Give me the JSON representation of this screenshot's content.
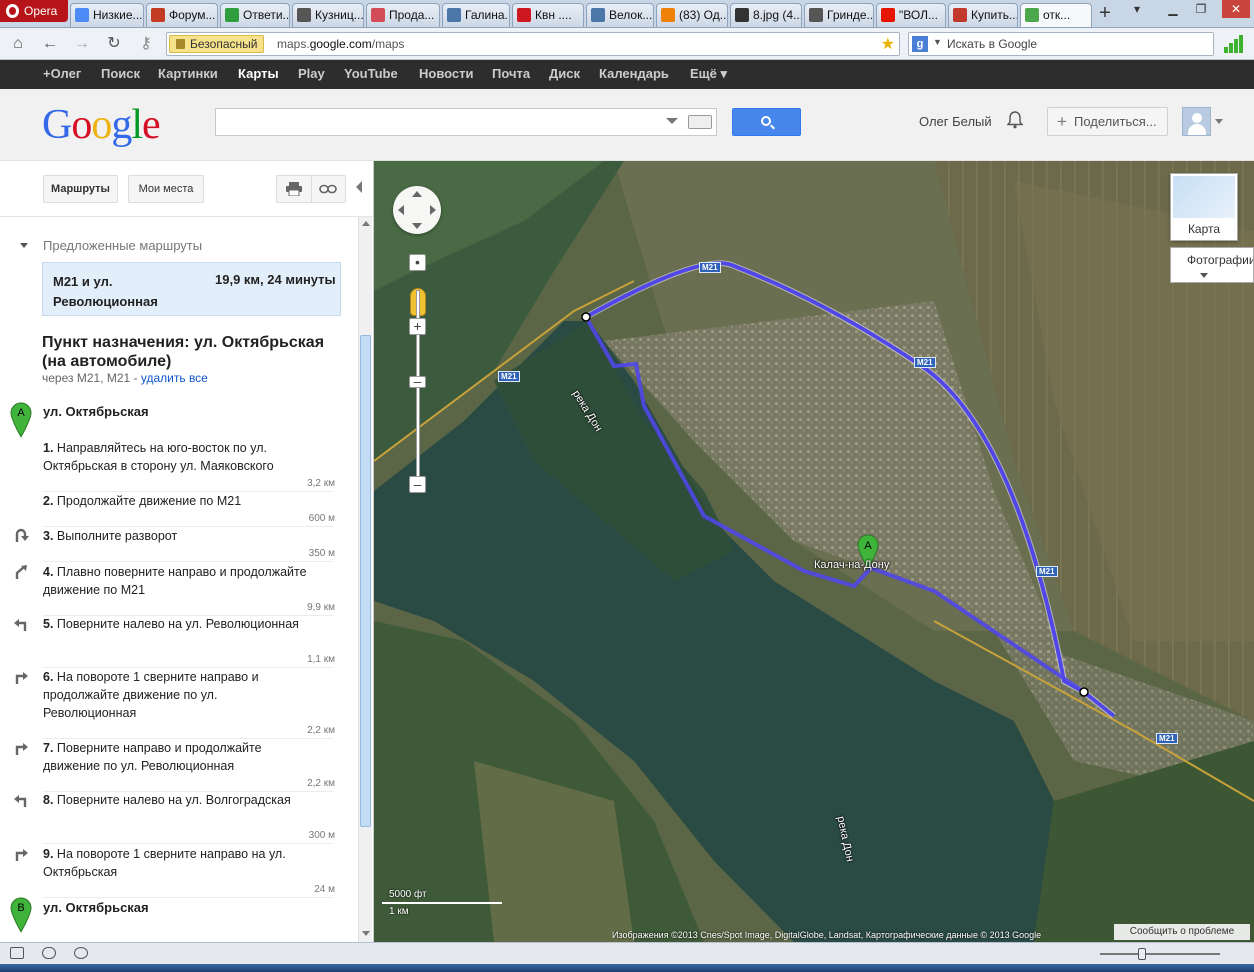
{
  "browser": {
    "menu_label": "Opera",
    "tabs": [
      {
        "label": "Низкие...",
        "icon": "chrome-icon",
        "color": "#4c8bf5"
      },
      {
        "label": "Форум...",
        "icon": "bike-icon",
        "color": "#c23b22"
      },
      {
        "label": "Ответи...",
        "icon": "leaf-icon",
        "color": "#2e9e3e"
      },
      {
        "label": "Кузниц...",
        "icon": "gear-icon",
        "color": "#555555"
      },
      {
        "label": "Прода...",
        "icon": "dots-icon",
        "color": "#d24d57"
      },
      {
        "label": "Галина...",
        "icon": "vk-icon",
        "color": "#4a76a8"
      },
      {
        "label": "Квн ....",
        "icon": "youtube-icon",
        "color": "#cc181e"
      },
      {
        "label": "Велок...",
        "icon": "vk-icon",
        "color": "#4a76a8"
      },
      {
        "label": "(83) Од...",
        "icon": "ok-icon",
        "color": "#ee8208"
      },
      {
        "label": "8.jpg (4...",
        "icon": "image-icon",
        "color": "#333333"
      },
      {
        "label": "Гринде...",
        "icon": "gear-icon",
        "color": "#555555"
      },
      {
        "label": "\"ВОЛ...",
        "icon": "yandex-icon",
        "color": "#e61400"
      },
      {
        "label": "Купить...",
        "icon": "vt-icon",
        "color": "#c0392b"
      },
      {
        "label": "отк...",
        "icon": "maps-icon",
        "color": "#4ca64c"
      }
    ],
    "security_label": "Безопасный",
    "url_prefix": "maps.",
    "url_domain": "google.com",
    "url_suffix": "/maps",
    "search_placeholder": "Искать в Google"
  },
  "gbar": {
    "items": [
      "+Олег",
      "Поиск",
      "Картинки",
      "Карты",
      "Play",
      "YouTube",
      "Новости",
      "Почта",
      "Диск",
      "Календарь",
      "Ещё ▾"
    ],
    "active_index": 3
  },
  "header": {
    "logo_letters": [
      {
        "ch": "G",
        "color": "#3369e8"
      },
      {
        "ch": "o",
        "color": "#d50f25"
      },
      {
        "ch": "o",
        "color": "#eeb211"
      },
      {
        "ch": "g",
        "color": "#3369e8"
      },
      {
        "ch": "l",
        "color": "#009925"
      },
      {
        "ch": "e",
        "color": "#d50f25"
      }
    ],
    "search_value": "",
    "username": "Олег Белый",
    "share_label": "Поделиться..."
  },
  "panel": {
    "routes_btn": "Маршруты",
    "places_btn": "Мои места",
    "suggested_header": "Предложенные маршруты",
    "route_name": "M21 и ул. Революционная",
    "route_summary": "19,9 км, 24 минуты",
    "destination_title": "Пункт назначения: ул. Октябрьская (на автомобиле)",
    "via_text": "через M21, M21 - ",
    "remove_all": "удалить все",
    "start_label": "ул. Октябрьская",
    "end_label": "ул. Октябрьская",
    "steps": [
      {
        "num": "1.",
        "text": "Направляйтесь на юго-восток по ул. Октябрьская в сторону ул. Маяковского",
        "dist": "3,2 км",
        "icon": "none"
      },
      {
        "num": "2.",
        "text": "Продолжайте движение по M21",
        "dist": "600 м",
        "icon": "none"
      },
      {
        "num": "3.",
        "text": "Выполните разворот",
        "dist": "350 м",
        "icon": "u-turn-icon"
      },
      {
        "num": "4.",
        "text": "Плавно поверните направо и продолжайте движение по M21",
        "dist": "9,9 км",
        "icon": "slight-right-icon"
      },
      {
        "num": "5.",
        "text": "Поверните налево на ул. Революционная",
        "dist": "1,1 км",
        "icon": "turn-left-icon"
      },
      {
        "num": "6.",
        "text": "На повороте 1 сверните направо и продолжайте движение по ул. Революционная",
        "dist": "2,2 км",
        "icon": "turn-right-icon"
      },
      {
        "num": "7.",
        "text": "Поверните направо и продолжайте движение по ул. Революционная",
        "dist": "2,2 км",
        "icon": "turn-right-icon"
      },
      {
        "num": "8.",
        "text": "Поверните налево на ул. Волгоградская",
        "dist": "300 м",
        "icon": "turn-left-icon"
      },
      {
        "num": "9.",
        "text": "На повороте 1 сверните направо на ул. Октябрьская",
        "dist": "24 м",
        "icon": "turn-right-icon"
      }
    ]
  },
  "map": {
    "maptype_map": "Карта",
    "maptype_sat": "Фотографии",
    "city_label": "Калач-на-Дону",
    "river_label_1": "река Дон",
    "river_label_2": "река Дон",
    "road_label": "M21",
    "pin_a": "A",
    "pin_b": "B",
    "scale_imperial": "5000 фт",
    "scale_metric": "1 км",
    "attribution": "Изображения ©2013 Cnes/Spot Image, DigitalGlobe, Landsat, Картографические данные © 2013 Google",
    "report_label": "Сообщить о проблеме",
    "route_color": "#5147e8"
  }
}
